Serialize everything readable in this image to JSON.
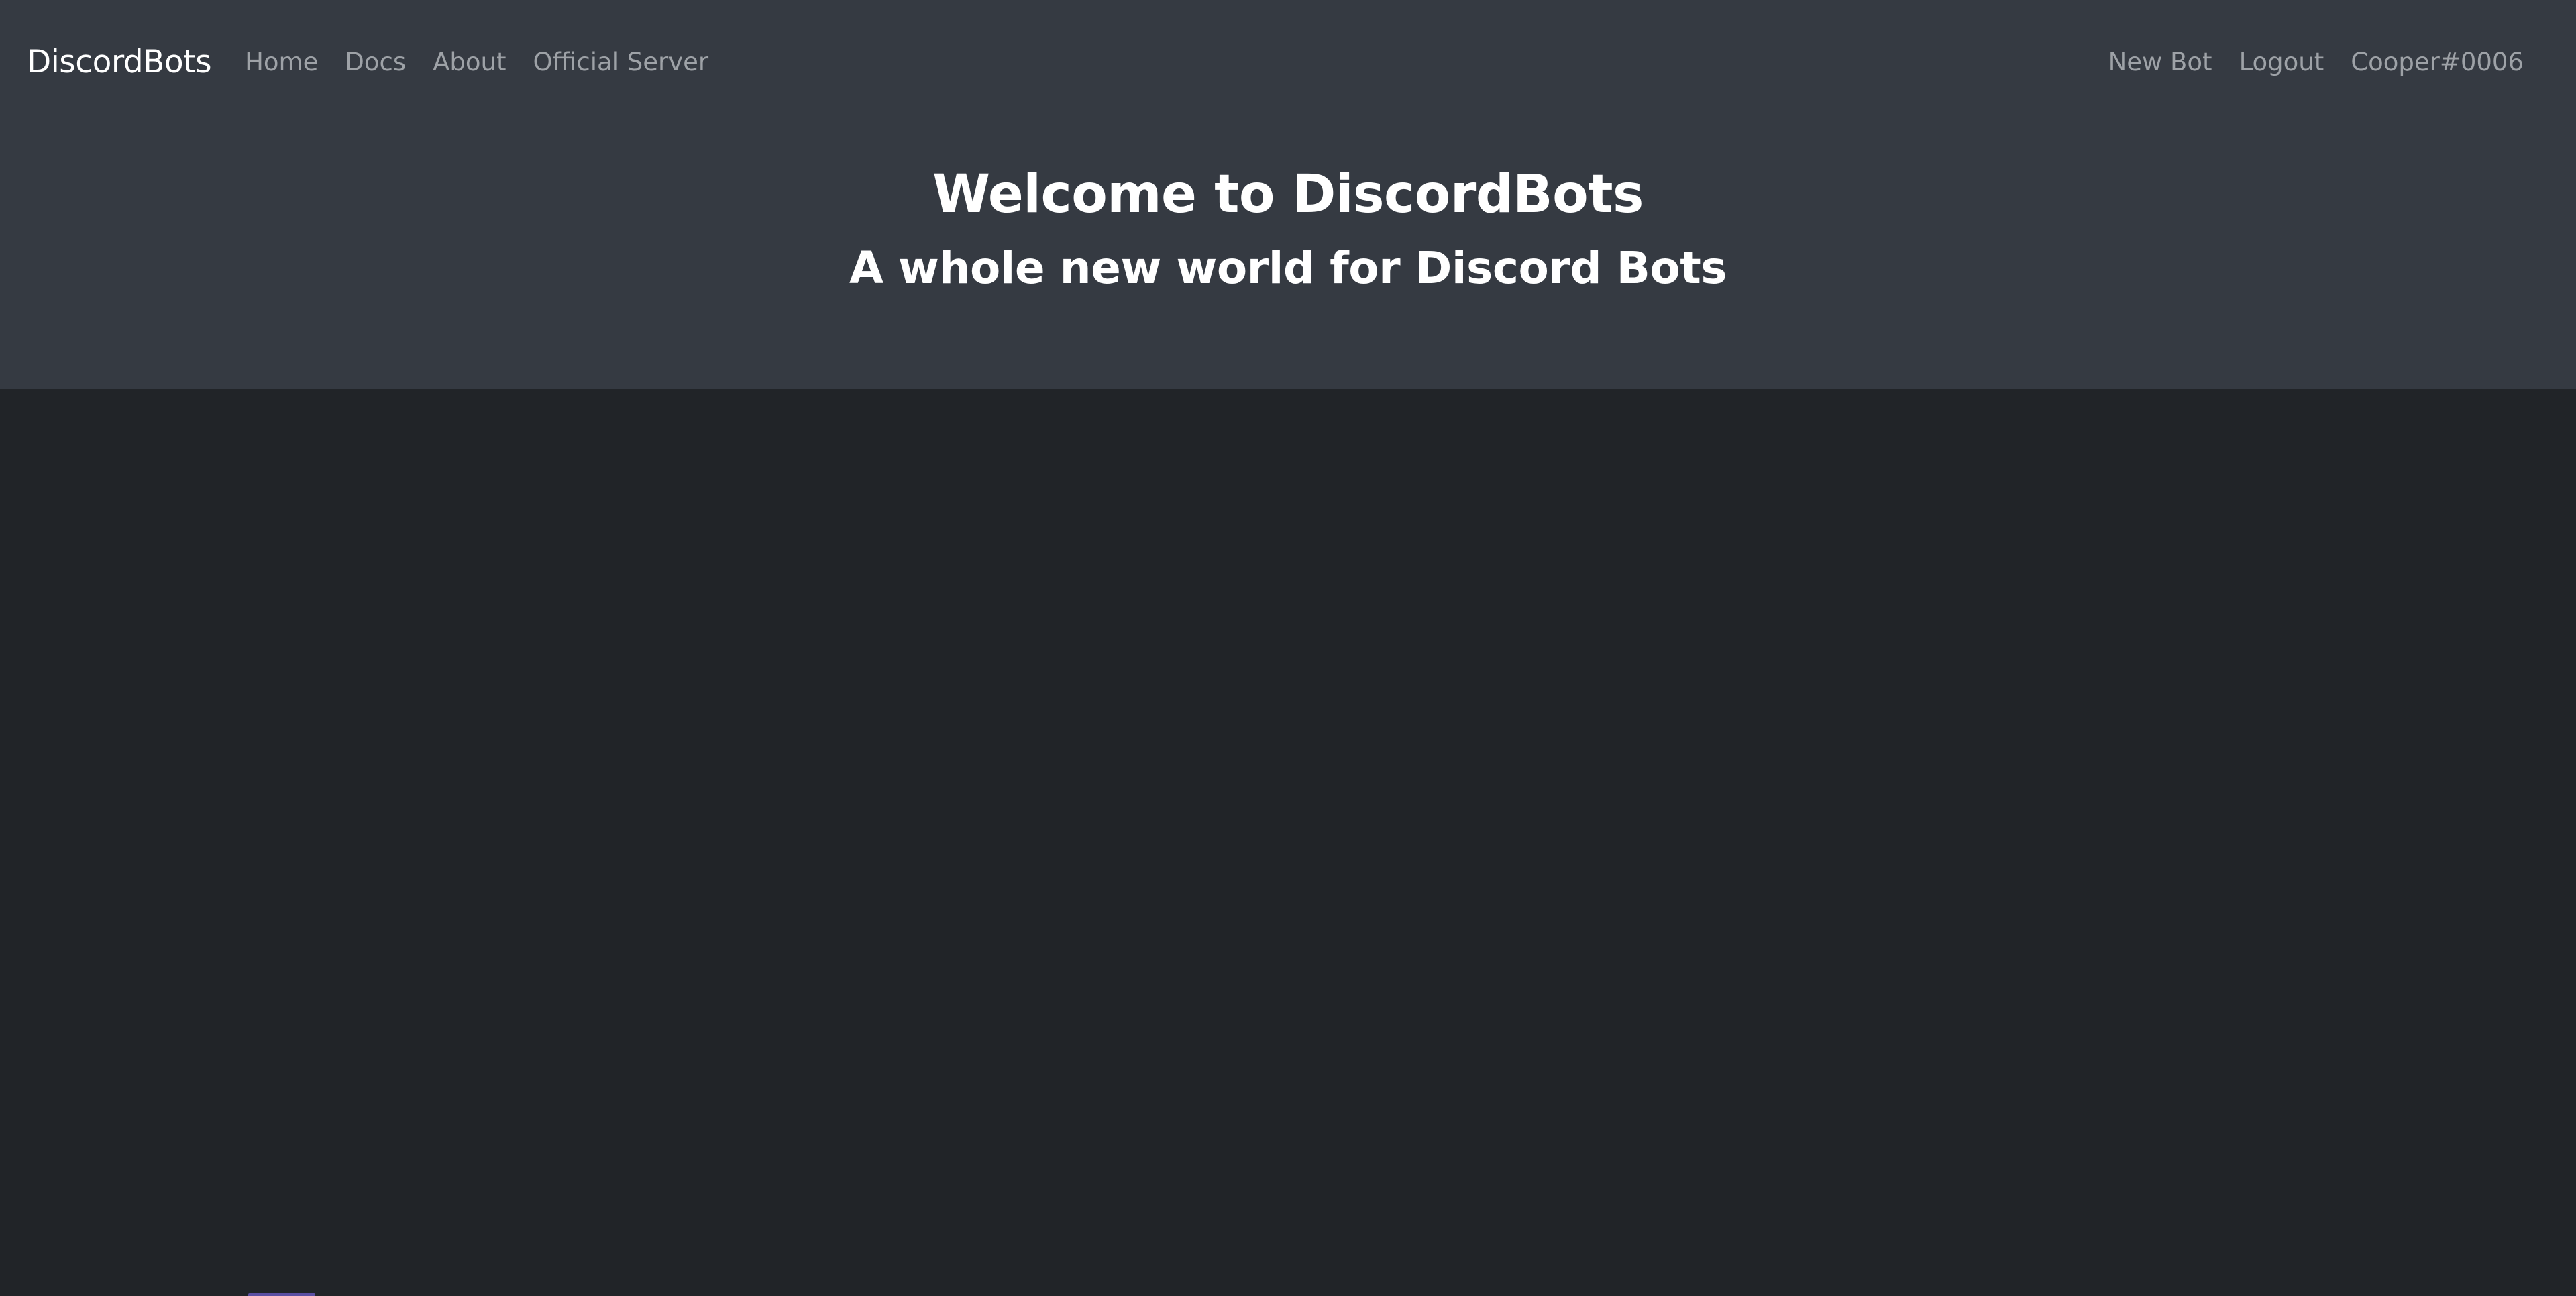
{
  "navbar": {
    "brand": "DiscordBots",
    "left_links": [
      {
        "label": "Home"
      },
      {
        "label": "Docs"
      },
      {
        "label": "About"
      },
      {
        "label": "Official Server"
      }
    ],
    "right_links": [
      {
        "label": "New Bot"
      },
      {
        "label": "Logout"
      },
      {
        "label": "Cooper#0006"
      }
    ]
  },
  "hero": {
    "title": "Welcome to DiscordBots",
    "subtitle": "A whole new world for Discord Bots"
  },
  "colors": {
    "header_background": "#353a42",
    "page_background": "#212428",
    "nav_link": "#9ea2a7",
    "brand_text": "#ffffff",
    "accent": "#5b4fa3"
  }
}
